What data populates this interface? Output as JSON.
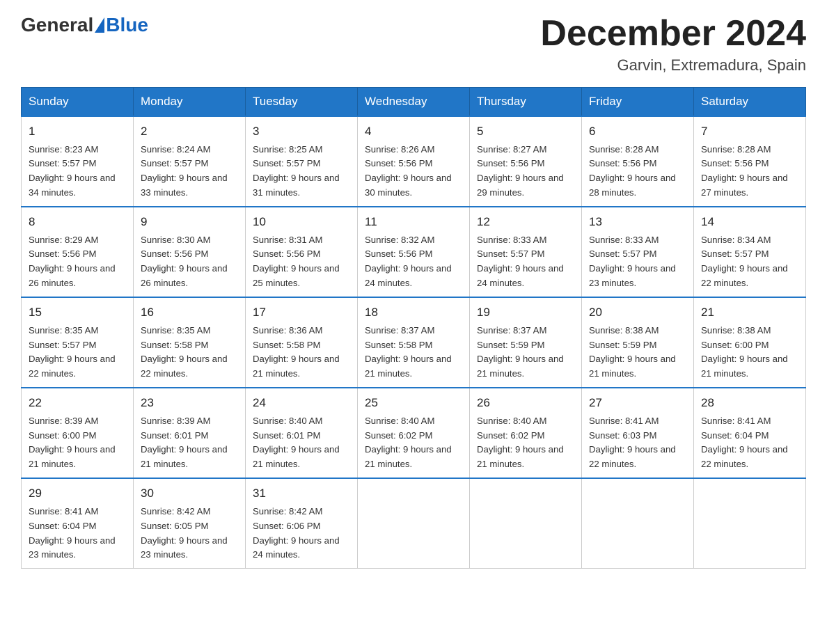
{
  "header": {
    "logo_general": "General",
    "logo_blue": "Blue",
    "month_title": "December 2024",
    "location": "Garvin, Extremadura, Spain"
  },
  "weekdays": [
    "Sunday",
    "Monday",
    "Tuesday",
    "Wednesday",
    "Thursday",
    "Friday",
    "Saturday"
  ],
  "weeks": [
    [
      {
        "day": "1",
        "sunrise": "Sunrise: 8:23 AM",
        "sunset": "Sunset: 5:57 PM",
        "daylight": "Daylight: 9 hours and 34 minutes."
      },
      {
        "day": "2",
        "sunrise": "Sunrise: 8:24 AM",
        "sunset": "Sunset: 5:57 PM",
        "daylight": "Daylight: 9 hours and 33 minutes."
      },
      {
        "day": "3",
        "sunrise": "Sunrise: 8:25 AM",
        "sunset": "Sunset: 5:57 PM",
        "daylight": "Daylight: 9 hours and 31 minutes."
      },
      {
        "day": "4",
        "sunrise": "Sunrise: 8:26 AM",
        "sunset": "Sunset: 5:56 PM",
        "daylight": "Daylight: 9 hours and 30 minutes."
      },
      {
        "day": "5",
        "sunrise": "Sunrise: 8:27 AM",
        "sunset": "Sunset: 5:56 PM",
        "daylight": "Daylight: 9 hours and 29 minutes."
      },
      {
        "day": "6",
        "sunrise": "Sunrise: 8:28 AM",
        "sunset": "Sunset: 5:56 PM",
        "daylight": "Daylight: 9 hours and 28 minutes."
      },
      {
        "day": "7",
        "sunrise": "Sunrise: 8:28 AM",
        "sunset": "Sunset: 5:56 PM",
        "daylight": "Daylight: 9 hours and 27 minutes."
      }
    ],
    [
      {
        "day": "8",
        "sunrise": "Sunrise: 8:29 AM",
        "sunset": "Sunset: 5:56 PM",
        "daylight": "Daylight: 9 hours and 26 minutes."
      },
      {
        "day": "9",
        "sunrise": "Sunrise: 8:30 AM",
        "sunset": "Sunset: 5:56 PM",
        "daylight": "Daylight: 9 hours and 26 minutes."
      },
      {
        "day": "10",
        "sunrise": "Sunrise: 8:31 AM",
        "sunset": "Sunset: 5:56 PM",
        "daylight": "Daylight: 9 hours and 25 minutes."
      },
      {
        "day": "11",
        "sunrise": "Sunrise: 8:32 AM",
        "sunset": "Sunset: 5:56 PM",
        "daylight": "Daylight: 9 hours and 24 minutes."
      },
      {
        "day": "12",
        "sunrise": "Sunrise: 8:33 AM",
        "sunset": "Sunset: 5:57 PM",
        "daylight": "Daylight: 9 hours and 24 minutes."
      },
      {
        "day": "13",
        "sunrise": "Sunrise: 8:33 AM",
        "sunset": "Sunset: 5:57 PM",
        "daylight": "Daylight: 9 hours and 23 minutes."
      },
      {
        "day": "14",
        "sunrise": "Sunrise: 8:34 AM",
        "sunset": "Sunset: 5:57 PM",
        "daylight": "Daylight: 9 hours and 22 minutes."
      }
    ],
    [
      {
        "day": "15",
        "sunrise": "Sunrise: 8:35 AM",
        "sunset": "Sunset: 5:57 PM",
        "daylight": "Daylight: 9 hours and 22 minutes."
      },
      {
        "day": "16",
        "sunrise": "Sunrise: 8:35 AM",
        "sunset": "Sunset: 5:58 PM",
        "daylight": "Daylight: 9 hours and 22 minutes."
      },
      {
        "day": "17",
        "sunrise": "Sunrise: 8:36 AM",
        "sunset": "Sunset: 5:58 PM",
        "daylight": "Daylight: 9 hours and 21 minutes."
      },
      {
        "day": "18",
        "sunrise": "Sunrise: 8:37 AM",
        "sunset": "Sunset: 5:58 PM",
        "daylight": "Daylight: 9 hours and 21 minutes."
      },
      {
        "day": "19",
        "sunrise": "Sunrise: 8:37 AM",
        "sunset": "Sunset: 5:59 PM",
        "daylight": "Daylight: 9 hours and 21 minutes."
      },
      {
        "day": "20",
        "sunrise": "Sunrise: 8:38 AM",
        "sunset": "Sunset: 5:59 PM",
        "daylight": "Daylight: 9 hours and 21 minutes."
      },
      {
        "day": "21",
        "sunrise": "Sunrise: 8:38 AM",
        "sunset": "Sunset: 6:00 PM",
        "daylight": "Daylight: 9 hours and 21 minutes."
      }
    ],
    [
      {
        "day": "22",
        "sunrise": "Sunrise: 8:39 AM",
        "sunset": "Sunset: 6:00 PM",
        "daylight": "Daylight: 9 hours and 21 minutes."
      },
      {
        "day": "23",
        "sunrise": "Sunrise: 8:39 AM",
        "sunset": "Sunset: 6:01 PM",
        "daylight": "Daylight: 9 hours and 21 minutes."
      },
      {
        "day": "24",
        "sunrise": "Sunrise: 8:40 AM",
        "sunset": "Sunset: 6:01 PM",
        "daylight": "Daylight: 9 hours and 21 minutes."
      },
      {
        "day": "25",
        "sunrise": "Sunrise: 8:40 AM",
        "sunset": "Sunset: 6:02 PM",
        "daylight": "Daylight: 9 hours and 21 minutes."
      },
      {
        "day": "26",
        "sunrise": "Sunrise: 8:40 AM",
        "sunset": "Sunset: 6:02 PM",
        "daylight": "Daylight: 9 hours and 21 minutes."
      },
      {
        "day": "27",
        "sunrise": "Sunrise: 8:41 AM",
        "sunset": "Sunset: 6:03 PM",
        "daylight": "Daylight: 9 hours and 22 minutes."
      },
      {
        "day": "28",
        "sunrise": "Sunrise: 8:41 AM",
        "sunset": "Sunset: 6:04 PM",
        "daylight": "Daylight: 9 hours and 22 minutes."
      }
    ],
    [
      {
        "day": "29",
        "sunrise": "Sunrise: 8:41 AM",
        "sunset": "Sunset: 6:04 PM",
        "daylight": "Daylight: 9 hours and 23 minutes."
      },
      {
        "day": "30",
        "sunrise": "Sunrise: 8:42 AM",
        "sunset": "Sunset: 6:05 PM",
        "daylight": "Daylight: 9 hours and 23 minutes."
      },
      {
        "day": "31",
        "sunrise": "Sunrise: 8:42 AM",
        "sunset": "Sunset: 6:06 PM",
        "daylight": "Daylight: 9 hours and 24 minutes."
      },
      null,
      null,
      null,
      null
    ]
  ]
}
